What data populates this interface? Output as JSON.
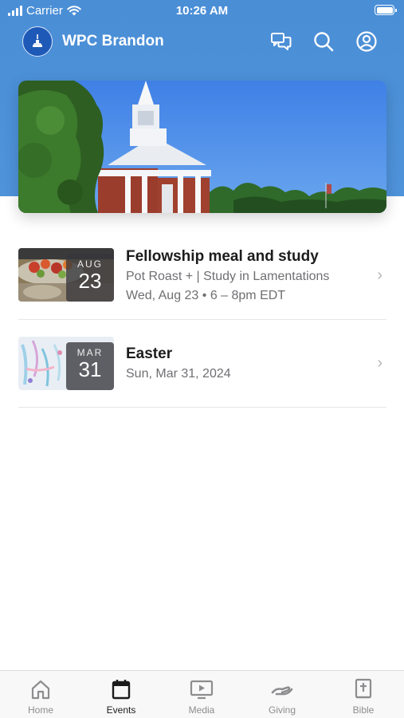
{
  "status_bar": {
    "carrier": "Carrier",
    "time": "10:26 AM"
  },
  "header": {
    "title": "WPC Brandon",
    "icons": [
      "chat-bubbles-icon",
      "search-icon",
      "profile-icon"
    ]
  },
  "hero": {
    "image": "church-steeple-photo"
  },
  "events": [
    {
      "month": "AUG",
      "day": "23",
      "title": "Fellowship meal and study",
      "subtitle": "Pot Roast +  |  Study in Lamentations",
      "when": "Wed, Aug 23 • 6 – 8pm EDT"
    },
    {
      "month": "MAR",
      "day": "31",
      "title": "Easter",
      "when": "Sun, Mar 31, 2024"
    }
  ],
  "tabs": [
    {
      "label": "Home",
      "icon": "home-icon"
    },
    {
      "label": "Events",
      "icon": "calendar-icon",
      "active": true
    },
    {
      "label": "Media",
      "icon": "tv-play-icon"
    },
    {
      "label": "Giving",
      "icon": "giving-hand-icon"
    },
    {
      "label": "Bible",
      "icon": "bible-icon"
    }
  ],
  "colors": {
    "header_blue": "#4a8ed6",
    "logo_blue": "#1f59b8",
    "tab_inactive": "#8d8d90"
  }
}
